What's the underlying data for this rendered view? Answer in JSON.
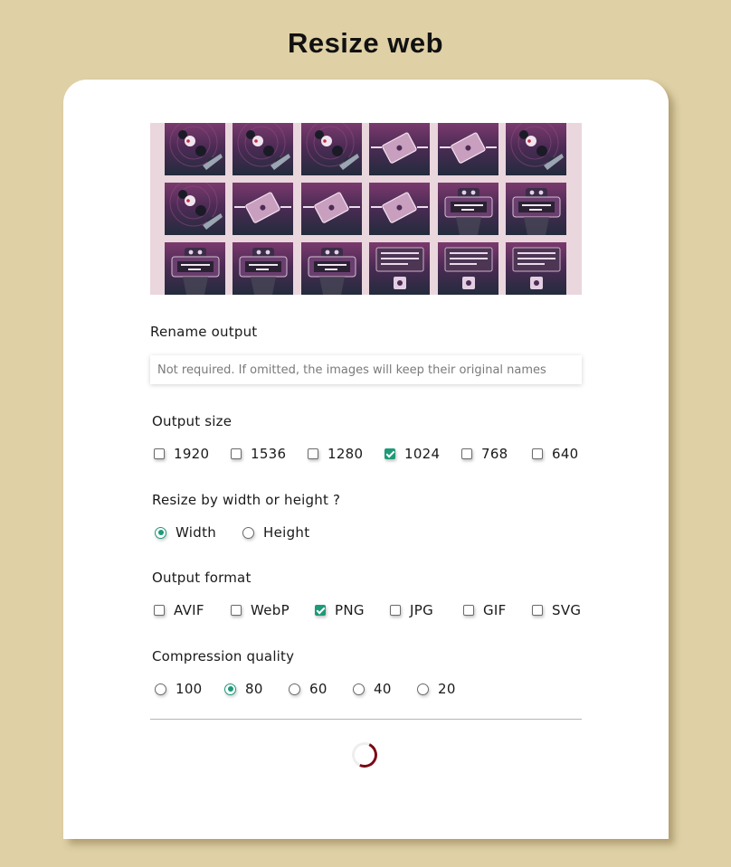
{
  "page": {
    "title": "Resize web"
  },
  "thumbnails": [
    {
      "kind": "meter"
    },
    {
      "kind": "meter"
    },
    {
      "kind": "meter"
    },
    {
      "kind": "card"
    },
    {
      "kind": "card"
    },
    {
      "kind": "meter"
    },
    {
      "kind": "meter"
    },
    {
      "kind": "card"
    },
    {
      "kind": "card"
    },
    {
      "kind": "card"
    },
    {
      "kind": "robot"
    },
    {
      "kind": "robot"
    },
    {
      "kind": "robot"
    },
    {
      "kind": "robot"
    },
    {
      "kind": "robot"
    },
    {
      "kind": "board"
    },
    {
      "kind": "board"
    },
    {
      "kind": "board"
    }
  ],
  "rename": {
    "label": "Rename output",
    "placeholder": "Not required. If omitted, the images will keep their original names",
    "value": ""
  },
  "output_size": {
    "label": "Output size",
    "options": [
      {
        "label": "1920",
        "checked": false
      },
      {
        "label": "1536",
        "checked": false
      },
      {
        "label": "1280",
        "checked": false
      },
      {
        "label": "1024",
        "checked": true
      },
      {
        "label": "768",
        "checked": false
      },
      {
        "label": "640",
        "checked": false
      }
    ]
  },
  "resize_by": {
    "label": "Resize by width or height ?",
    "options": [
      {
        "label": "Width",
        "checked": true
      },
      {
        "label": "Height",
        "checked": false
      }
    ]
  },
  "output_format": {
    "label": "Output format",
    "options": [
      {
        "label": "AVIF",
        "checked": false
      },
      {
        "label": "WebP",
        "checked": false
      },
      {
        "label": "PNG",
        "checked": true
      },
      {
        "label": "JPG",
        "checked": false
      },
      {
        "label": "GIF",
        "checked": false
      },
      {
        "label": "SVG",
        "checked": false
      }
    ]
  },
  "compression": {
    "label": "Compression quality",
    "options": [
      {
        "label": "100",
        "checked": false
      },
      {
        "label": "80",
        "checked": true
      },
      {
        "label": "60",
        "checked": false
      },
      {
        "label": "40",
        "checked": false
      },
      {
        "label": "20",
        "checked": false
      }
    ]
  },
  "colors": {
    "accent": "#1e9a78",
    "background": "#dfd0a6",
    "spinner": "#7a0a14"
  },
  "icons": {
    "loading": "spinner-icon"
  }
}
